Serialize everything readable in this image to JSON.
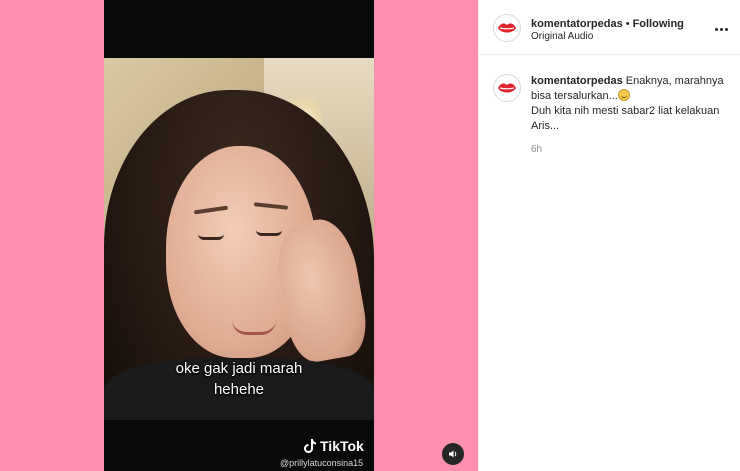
{
  "video": {
    "caption_line1": "oke gak jadi marah",
    "caption_line2": "hehehe",
    "watermark": "TikTok",
    "watermark_handle": "@prillylatuconsina15"
  },
  "post": {
    "username": "komentatorpedas",
    "separator": "•",
    "follow_status": "Following",
    "audio_label": "Original Audio"
  },
  "comment": {
    "username": "komentatorpedas",
    "text_part1": "Enaknya, marahnya bisa tersalurkan...",
    "text_part2": "Duh kita nih mesti sabar2 liat kelakuan Aris...",
    "time": "6h"
  },
  "colors": {
    "background_pink": "#ff8fae",
    "text_primary": "#262626",
    "text_secondary": "#8e8e8e"
  },
  "icons": [
    "tiktok-logo-icon",
    "volume-icon",
    "more-options-icon",
    "lips-avatar-icon",
    "grin-emoji-icon"
  ]
}
